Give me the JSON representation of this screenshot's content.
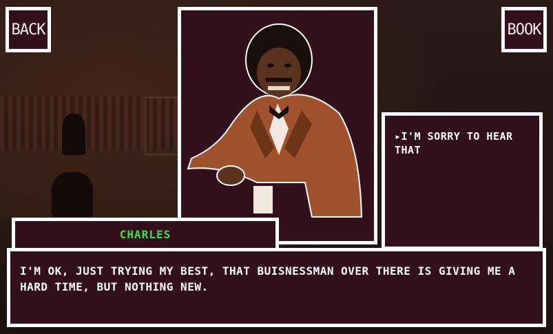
{
  "nav": {
    "back_label": "BACK",
    "book_label": "BOOK"
  },
  "speaker": {
    "name": "CHARLES"
  },
  "dialog": {
    "text": "I'M OK, JUST TRYING MY BEST, THAT BUISNESSMAN OVER THERE IS GIVING ME A HARD TIME, BUT NOTHING NEW."
  },
  "choices": [
    {
      "marker": "▸",
      "label": "I'M SORRY TO HEAR THAT"
    }
  ],
  "colors": {
    "panel": "#32101c",
    "border": "#ffffff",
    "name": "#3de33d",
    "suit": "#a0522d"
  }
}
